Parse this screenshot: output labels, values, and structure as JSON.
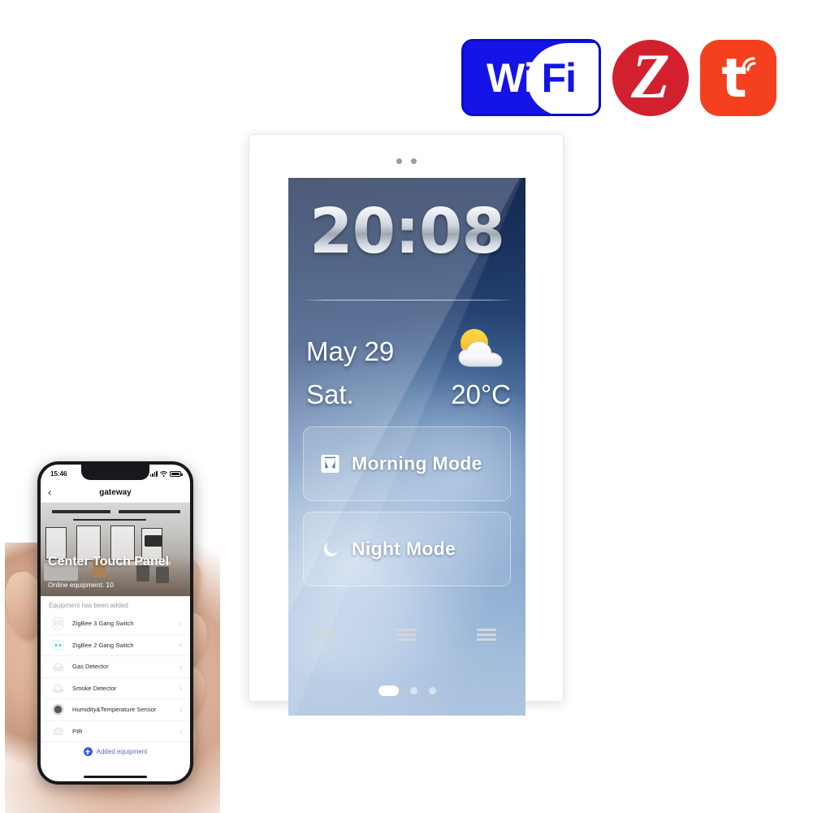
{
  "logos": [
    {
      "name": "wifi-logo",
      "wi": "Wi",
      "fi": "Fi",
      "color": "#1414E6"
    },
    {
      "name": "zigbee-logo",
      "letter": "Z",
      "color": "#D3202E"
    },
    {
      "name": "tuya-logo",
      "letter": "t",
      "color": "#F5401F"
    }
  ],
  "panel": {
    "screen": {
      "clock": "20:08",
      "date": "May 29",
      "weekday": "Sat.",
      "temperature": "20°C",
      "weather_icon": "sun-behind-cloud-icon",
      "modes": [
        {
          "label": "Morning Mode",
          "icon": "curtains-icon"
        },
        {
          "label": "Night Mode",
          "icon": "crescent-moon-icon"
        }
      ],
      "page_dots": {
        "count": 3,
        "active_index": 0
      }
    },
    "sensor_dots": 2,
    "touch_keys": [
      {
        "name": "touch-key-left",
        "icon": "menu-lines-icon"
      },
      {
        "name": "touch-key-center",
        "icon": "menu-lines-icon"
      },
      {
        "name": "touch-key-right",
        "icon": "menu-lines-icon"
      }
    ]
  },
  "phone": {
    "status_bar": {
      "time": "15:46",
      "signal_icon": "cellular-bars-icon",
      "wifi_icon": "wifi-icon",
      "battery_icon": "battery-full-icon"
    },
    "nav": {
      "back_icon": "chevron-left-icon",
      "title": "gateway"
    },
    "hero": {
      "title": "Center Touch Panel",
      "subtitle": "Online equipment: 10"
    },
    "list_header": "Equipment has been added",
    "devices": [
      {
        "label": "ZigBee 3 Gang Switch",
        "icon": "switch-3gang-icon",
        "chevron": "›"
      },
      {
        "label": "ZigBee 2 Gang Switch",
        "icon": "switch-2gang-icon",
        "chevron": "›"
      },
      {
        "label": "Gas Detector",
        "icon": "gas-detector-icon",
        "chevron": "›"
      },
      {
        "label": "Smoke Detector",
        "icon": "smoke-detector-icon",
        "chevron": "›"
      },
      {
        "label": "Humidity&Temperature Sensor",
        "icon": "humidity-temp-icon",
        "chevron": "›"
      },
      {
        "label": "PIR",
        "icon": "pir-sensor-icon",
        "chevron": "›"
      }
    ],
    "added_button": {
      "label": "Added equipment",
      "icon": "plus-circle-icon"
    }
  }
}
